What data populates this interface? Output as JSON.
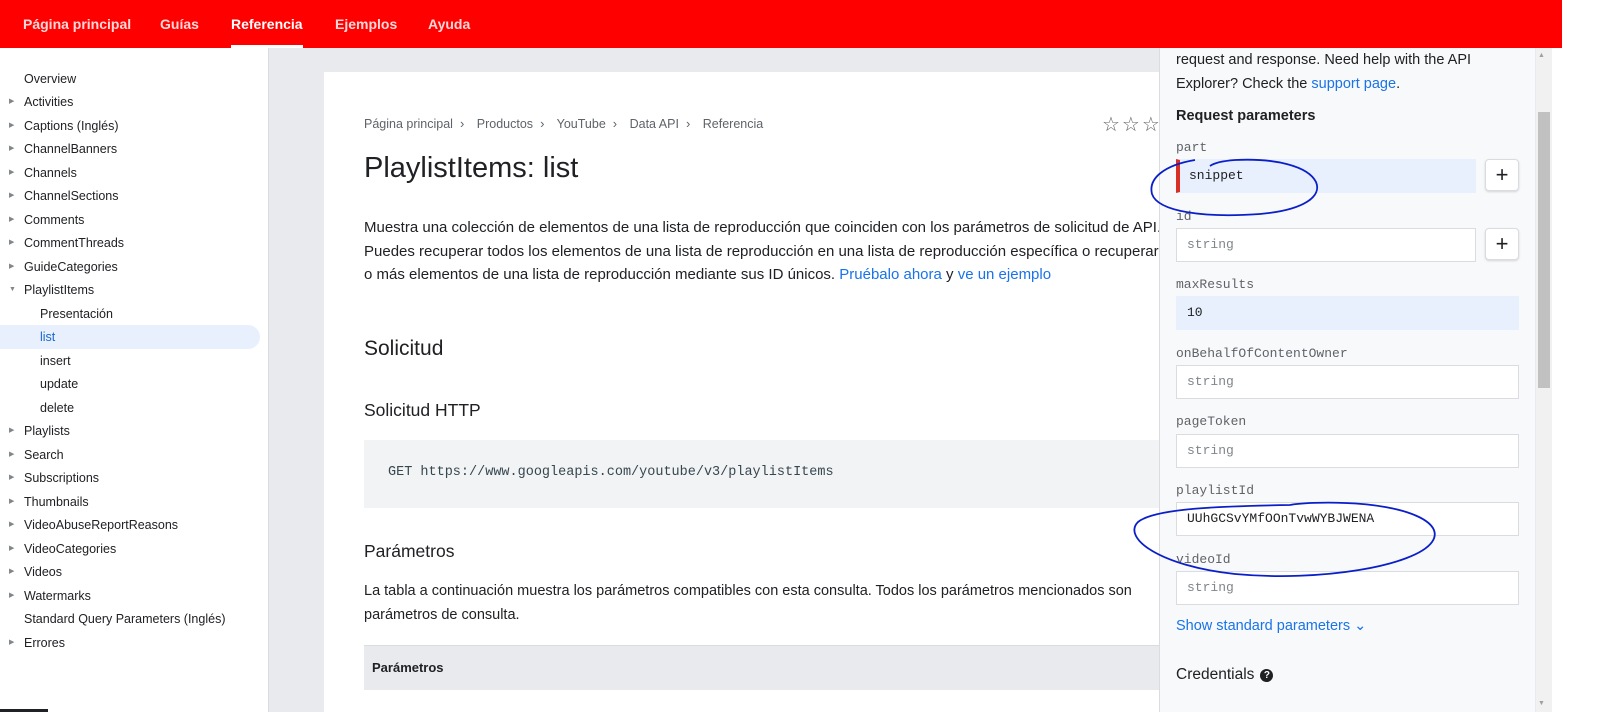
{
  "topnav": {
    "tabs": [
      {
        "label": "Página principal"
      },
      {
        "label": "Guías"
      },
      {
        "label": "Referencia"
      },
      {
        "label": "Ejemplos"
      },
      {
        "label": "Ayuda"
      }
    ],
    "active": "Referencia",
    "color": "#ff0000"
  },
  "sidebar": {
    "items": [
      {
        "label": "Overview"
      },
      {
        "label": "Activities"
      },
      {
        "label": "Captions (Inglés)"
      },
      {
        "label": "ChannelBanners"
      },
      {
        "label": "Channels"
      },
      {
        "label": "ChannelSections"
      },
      {
        "label": "Comments"
      },
      {
        "label": "CommentThreads"
      },
      {
        "label": "GuideCategories"
      },
      {
        "label": "PlaylistItems"
      },
      {
        "label": "Presentación"
      },
      {
        "label": "list"
      },
      {
        "label": "insert"
      },
      {
        "label": "update"
      },
      {
        "label": "delete"
      },
      {
        "label": "Playlists"
      },
      {
        "label": "Search"
      },
      {
        "label": "Subscriptions"
      },
      {
        "label": "Thumbnails"
      },
      {
        "label": "VideoAbuseReportReasons"
      },
      {
        "label": "VideoCategories"
      },
      {
        "label": "Videos"
      },
      {
        "label": "Watermarks"
      },
      {
        "label": "Standard Query Parameters (Inglés)"
      },
      {
        "label": "Errores"
      }
    ],
    "selected": "list"
  },
  "breadcrumbs": [
    "Página principal",
    "Productos",
    "YouTube",
    "Data API",
    "Referencia"
  ],
  "breadcrumb_separator": "›",
  "rating_stars": "☆☆☆☆",
  "page": {
    "title": "PlaylistItems: list",
    "description": "Muestra una colección de elementos de una lista de reproducción que coinciden con los parámetros de solicitud de API. Puedes recuperar todos los elementos de una lista de reproducción en una lista de reproducción específica o recuperar uno o más elementos de una lista de reproducción mediante sus ID únicos. ",
    "try_link": "Pruébalo ahora",
    "connector": " y ",
    "example_link": "ve un ejemplo",
    "section_request": "Solicitud",
    "section_http": "Solicitud HTTP",
    "http_request": "GET https://www.googleapis.com/youtube/v3/playlistItems",
    "section_params": "Parámetros",
    "params_desc": "La tabla a continuación muestra los parámetros compatibles con esta consulta. Todos los parámetros mencionados son parámetros de consulta.",
    "table_header": "Parámetros"
  },
  "explorer": {
    "intro": "request and response. Need help with the API Explorer? Check the ",
    "support_link": "support page",
    "intro_end": ".",
    "request_params_title": "Request parameters",
    "params": [
      {
        "name": "part",
        "value": "snippet"
      },
      {
        "name": "id",
        "placeholder": "string"
      },
      {
        "name": "maxResults",
        "value": "10"
      },
      {
        "name": "onBehalfOfContentOwner",
        "placeholder": "string"
      },
      {
        "name": "pageToken",
        "placeholder": "string"
      },
      {
        "name": "playlistId",
        "value": "UUhGCSvYMfOOnTvwWYBJWENA"
      },
      {
        "name": "videoId",
        "placeholder": "string"
      }
    ],
    "add_button": "+",
    "show_standard": "Show standard parameters",
    "show_standard_chevron": "⌄",
    "credentials_title": "Credentials",
    "help_icon": "?"
  },
  "colors": {
    "accent": "#1a73e8",
    "annotation": "#0a1fc9",
    "invalid_marker": "#d93025"
  },
  "scrollbar": {
    "up": "▲",
    "down": "▼"
  }
}
